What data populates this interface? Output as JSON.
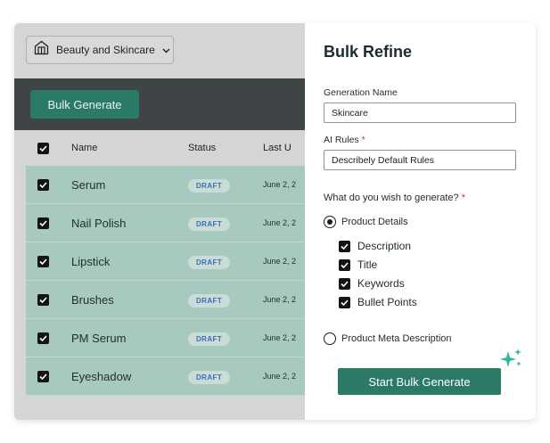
{
  "store_selector": {
    "label": "Beauty and Skincare",
    "icon": "store-icon"
  },
  "toolbar": {
    "bulk_generate_label": "Bulk Generate"
  },
  "table": {
    "columns": [
      "Name",
      "Status",
      "Last U"
    ],
    "rows": [
      {
        "name": "Serum",
        "status": "DRAFT",
        "date": "June 2, 2"
      },
      {
        "name": "Nail Polish",
        "status": "DRAFT",
        "date": "June 2, 2"
      },
      {
        "name": "Lipstick",
        "status": "DRAFT",
        "date": "June 2, 2"
      },
      {
        "name": "Brushes",
        "status": "DRAFT",
        "date": "June 2, 2"
      },
      {
        "name": "PM Serum",
        "status": "DRAFT",
        "date": "June 2, 2"
      },
      {
        "name": "Eyeshadow",
        "status": "DRAFT",
        "date": "June 2, 2"
      }
    ]
  },
  "panel": {
    "title": "Bulk Refine",
    "generation_name_label": "Generation Name",
    "generation_name_value": "Skincare",
    "ai_rules_label": "AI Rules",
    "ai_rules_value": "Describely Default Rules",
    "required_mark": "*",
    "question": "What do you wish to generate?",
    "option_product_details": "Product Details",
    "sub_options": [
      "Description",
      "Title",
      "Keywords",
      "Bullet Points"
    ],
    "option_meta": "Product Meta Description",
    "start_label": "Start Bulk Generate"
  },
  "colors": {
    "accent": "#2b7a68",
    "row_selected": "#a8c9bf",
    "required": "#c8334a",
    "badge_text": "#3a6fb5"
  }
}
